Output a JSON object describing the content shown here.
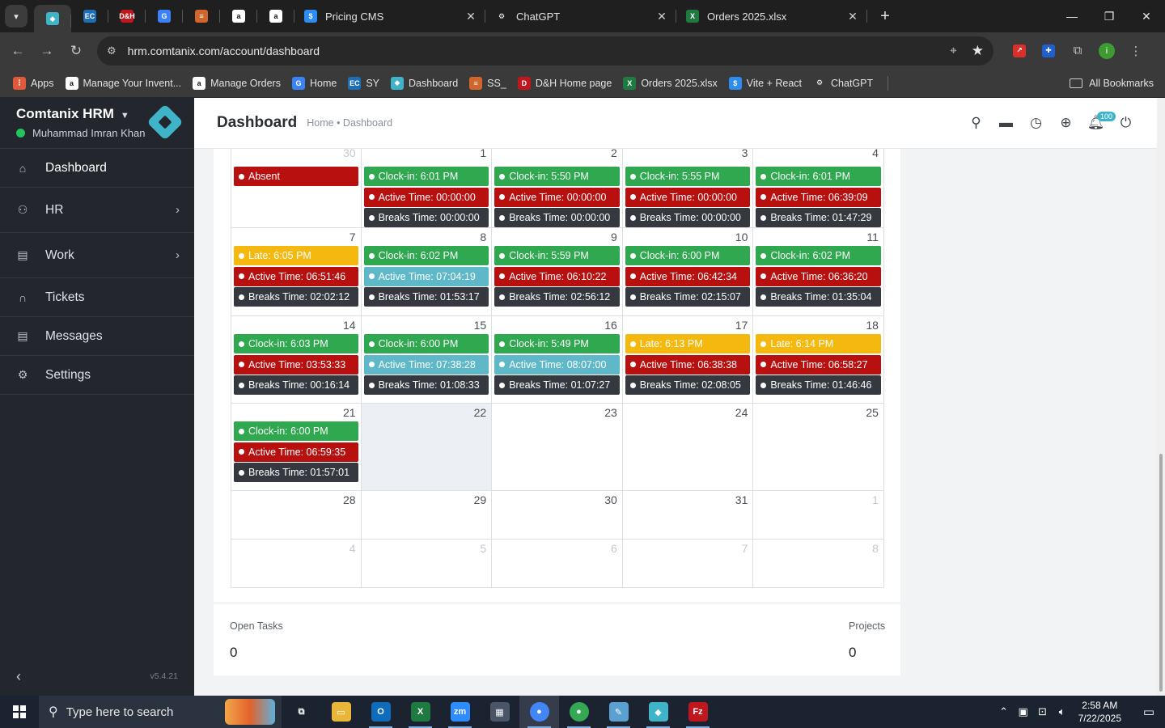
{
  "browser": {
    "tabs": [
      {
        "label": "Pricing CMS",
        "fav_color": "#2d8cf0",
        "fav_char": "$"
      },
      {
        "label": "ChatGPT",
        "fav_color": "#1f1f1f",
        "fav_char": "⚙"
      },
      {
        "label": "Orders 2025.xlsx",
        "fav_color": "#1e7a41",
        "fav_char": "X"
      }
    ],
    "pinned": [
      {
        "name": "hrm",
        "color": "#3fb4c9",
        "char": "◆"
      },
      {
        "name": "ec",
        "color": "#1c6fb5",
        "char": "EC"
      },
      {
        "name": "dh",
        "color": "#c0171e",
        "char": "D&H"
      },
      {
        "name": "g",
        "color": "#3b82f6",
        "char": "G"
      },
      {
        "name": "stack",
        "color": "#d2652b",
        "char": "≡"
      },
      {
        "name": "amazon1",
        "color": "#ffffff",
        "char": "a"
      },
      {
        "name": "amazon2",
        "color": "#ffffff",
        "char": "a"
      }
    ],
    "url": "hrm.comtanix.com/account/dashboard",
    "bookmarks": [
      {
        "label": "Apps",
        "color": "#e0593a",
        "char": "⋮"
      },
      {
        "label": "Manage Your Invent...",
        "color": "#ffffff",
        "char": "a"
      },
      {
        "label": "Manage Orders",
        "color": "#ffffff",
        "char": "a"
      },
      {
        "label": "Home",
        "color": "#3b82f6",
        "char": "G"
      },
      {
        "label": "SY",
        "color": "#1c6fb5",
        "char": "EC"
      },
      {
        "label": "Dashboard",
        "color": "#3fb4c9",
        "char": "◆"
      },
      {
        "label": "SS_",
        "color": "#d2652b",
        "char": "≡"
      },
      {
        "label": "D&H Home page",
        "color": "#c0171e",
        "char": "D"
      },
      {
        "label": "Orders 2025.xlsx",
        "color": "#1e7a41",
        "char": "X"
      },
      {
        "label": "Vite + React",
        "color": "#2d8cf0",
        "char": "$"
      },
      {
        "label": "ChatGPT",
        "color": "#3a3a3a",
        "char": "⚙"
      }
    ],
    "all_bookmarks": "All Bookmarks"
  },
  "sidebar": {
    "app_name": "Comtanix HRM",
    "user_name": "Muhammad Imran Khan",
    "items": [
      {
        "label": "Dashboard",
        "icon": "home-icon"
      },
      {
        "label": "HR",
        "icon": "users-icon"
      },
      {
        "label": "Work",
        "icon": "briefcase-icon"
      },
      {
        "label": "Tickets",
        "icon": "headset-icon"
      },
      {
        "label": "Messages",
        "icon": "message-icon"
      },
      {
        "label": "Settings",
        "icon": "gear-icon"
      }
    ],
    "version": "v5.4.21"
  },
  "header": {
    "title": "Dashboard",
    "breadcrumb": "Home • Dashboard",
    "notification_count": "100"
  },
  "calendar": {
    "weeks": [
      [
        {
          "day": "30",
          "muted": true,
          "events": [
            {
              "type": "red",
              "text": "Absent"
            }
          ]
        },
        {
          "day": "1",
          "events": [
            {
              "type": "green",
              "text": "Clock-in: 6:01 PM"
            },
            {
              "type": "red",
              "text": "Active Time: 00:00:00"
            },
            {
              "type": "dark",
              "text": "Breaks Time: 00:00:00"
            }
          ]
        },
        {
          "day": "2",
          "events": [
            {
              "type": "green",
              "text": "Clock-in: 5:50 PM"
            },
            {
              "type": "red",
              "text": "Active Time: 00:00:00"
            },
            {
              "type": "dark",
              "text": "Breaks Time: 00:00:00"
            }
          ]
        },
        {
          "day": "3",
          "events": [
            {
              "type": "green",
              "text": "Clock-in: 5:55 PM"
            },
            {
              "type": "red",
              "text": "Active Time: 00:00:00"
            },
            {
              "type": "dark",
              "text": "Breaks Time: 00:00:00"
            }
          ]
        },
        {
          "day": "4",
          "events": [
            {
              "type": "green",
              "text": "Clock-in: 6:01 PM"
            },
            {
              "type": "red",
              "text": "Active Time: 06:39:09"
            },
            {
              "type": "dark",
              "text": "Breaks Time: 01:47:29"
            }
          ]
        }
      ],
      [
        {
          "day": "7",
          "events": [
            {
              "type": "yellow",
              "text": "Late: 6:05 PM"
            },
            {
              "type": "red",
              "text": "Active Time: 06:51:46"
            },
            {
              "type": "dark",
              "text": "Breaks Time: 02:02:12"
            }
          ]
        },
        {
          "day": "8",
          "events": [
            {
              "type": "green",
              "text": "Clock-in: 6:02 PM"
            },
            {
              "type": "teal",
              "text": "Active Time: 07:04:19"
            },
            {
              "type": "dark",
              "text": "Breaks Time: 01:53:17"
            }
          ]
        },
        {
          "day": "9",
          "events": [
            {
              "type": "green",
              "text": "Clock-in: 5:59 PM"
            },
            {
              "type": "red",
              "text": "Active Time: 06:10:22"
            },
            {
              "type": "dark",
              "text": "Breaks Time: 02:56:12"
            }
          ]
        },
        {
          "day": "10",
          "events": [
            {
              "type": "green",
              "text": "Clock-in: 6:00 PM"
            },
            {
              "type": "red",
              "text": "Active Time: 06:42:34"
            },
            {
              "type": "dark",
              "text": "Breaks Time: 02:15:07"
            }
          ]
        },
        {
          "day": "11",
          "events": [
            {
              "type": "green",
              "text": "Clock-in: 6:02 PM"
            },
            {
              "type": "red",
              "text": "Active Time: 06:36:20"
            },
            {
              "type": "dark",
              "text": "Breaks Time: 01:35:04"
            }
          ]
        }
      ],
      [
        {
          "day": "14",
          "events": [
            {
              "type": "green",
              "text": "Clock-in: 6:03 PM"
            },
            {
              "type": "red",
              "text": "Active Time: 03:53:33"
            },
            {
              "type": "dark",
              "text": "Breaks Time: 00:16:14"
            }
          ]
        },
        {
          "day": "15",
          "events": [
            {
              "type": "green",
              "text": "Clock-in: 6:00 PM"
            },
            {
              "type": "teal",
              "text": "Active Time: 07:38:28"
            },
            {
              "type": "dark",
              "text": "Breaks Time: 01:08:33"
            }
          ]
        },
        {
          "day": "16",
          "events": [
            {
              "type": "green",
              "text": "Clock-in: 5:49 PM"
            },
            {
              "type": "teal",
              "text": "Active Time: 08:07:00"
            },
            {
              "type": "dark",
              "text": "Breaks Time: 01:07:27"
            }
          ]
        },
        {
          "day": "17",
          "events": [
            {
              "type": "yellow",
              "text": "Late: 6:13 PM"
            },
            {
              "type": "red",
              "text": "Active Time: 06:38:38"
            },
            {
              "type": "dark",
              "text": "Breaks Time: 02:08:05"
            }
          ]
        },
        {
          "day": "18",
          "events": [
            {
              "type": "yellow",
              "text": "Late: 6:14 PM"
            },
            {
              "type": "red",
              "text": "Active Time: 06:58:27"
            },
            {
              "type": "dark",
              "text": "Breaks Time: 01:46:46"
            }
          ]
        }
      ],
      [
        {
          "day": "21",
          "events": [
            {
              "type": "green",
              "text": "Clock-in: 6:00 PM"
            },
            {
              "type": "red",
              "text": "Active Time: 06:59:35"
            },
            {
              "type": "dark",
              "text": "Breaks Time: 01:57:01"
            }
          ]
        },
        {
          "day": "22",
          "today": true,
          "events": []
        },
        {
          "day": "23",
          "events": []
        },
        {
          "day": "24",
          "events": []
        },
        {
          "day": "25",
          "events": []
        }
      ],
      [
        {
          "day": "28",
          "events": []
        },
        {
          "day": "29",
          "events": []
        },
        {
          "day": "30",
          "events": []
        },
        {
          "day": "31",
          "events": []
        },
        {
          "day": "1",
          "muted": true,
          "events": []
        }
      ],
      [
        {
          "day": "4",
          "muted": true,
          "events": []
        },
        {
          "day": "5",
          "muted": true,
          "events": []
        },
        {
          "day": "6",
          "muted": true,
          "events": []
        },
        {
          "day": "7",
          "muted": true,
          "events": []
        },
        {
          "day": "8",
          "muted": true,
          "events": []
        }
      ]
    ]
  },
  "stats": {
    "open_tasks_label": "Open Tasks",
    "open_tasks_value": "0",
    "projects_label": "Projects",
    "projects_value": "0"
  },
  "taskbar": {
    "search_placeholder": "Type here to search",
    "time": "2:58 AM",
    "date": "7/22/2025",
    "apps": [
      {
        "name": "task-view",
        "color": "#1b2230",
        "char": "⧉"
      },
      {
        "name": "file-explorer",
        "color": "#e8b73a",
        "char": "▭"
      },
      {
        "name": "outlook",
        "color": "#0f6cbd",
        "char": "O"
      },
      {
        "name": "excel",
        "color": "#1e7a41",
        "char": "X"
      },
      {
        "name": "zoom",
        "color": "#2d8cff",
        "char": "zm"
      },
      {
        "name": "calculator",
        "color": "#4a5568",
        "char": "▦"
      },
      {
        "name": "chrome",
        "color": "#4285f4",
        "char": "●"
      },
      {
        "name": "chrome-2",
        "color": "#34a853",
        "char": "●"
      },
      {
        "name": "notepad",
        "color": "#5aa0d0",
        "char": "✎"
      },
      {
        "name": "hrm-app",
        "color": "#3fb4c9",
        "char": "◆"
      },
      {
        "name": "filezilla",
        "color": "#c0171e",
        "char": "Fz"
      }
    ]
  }
}
